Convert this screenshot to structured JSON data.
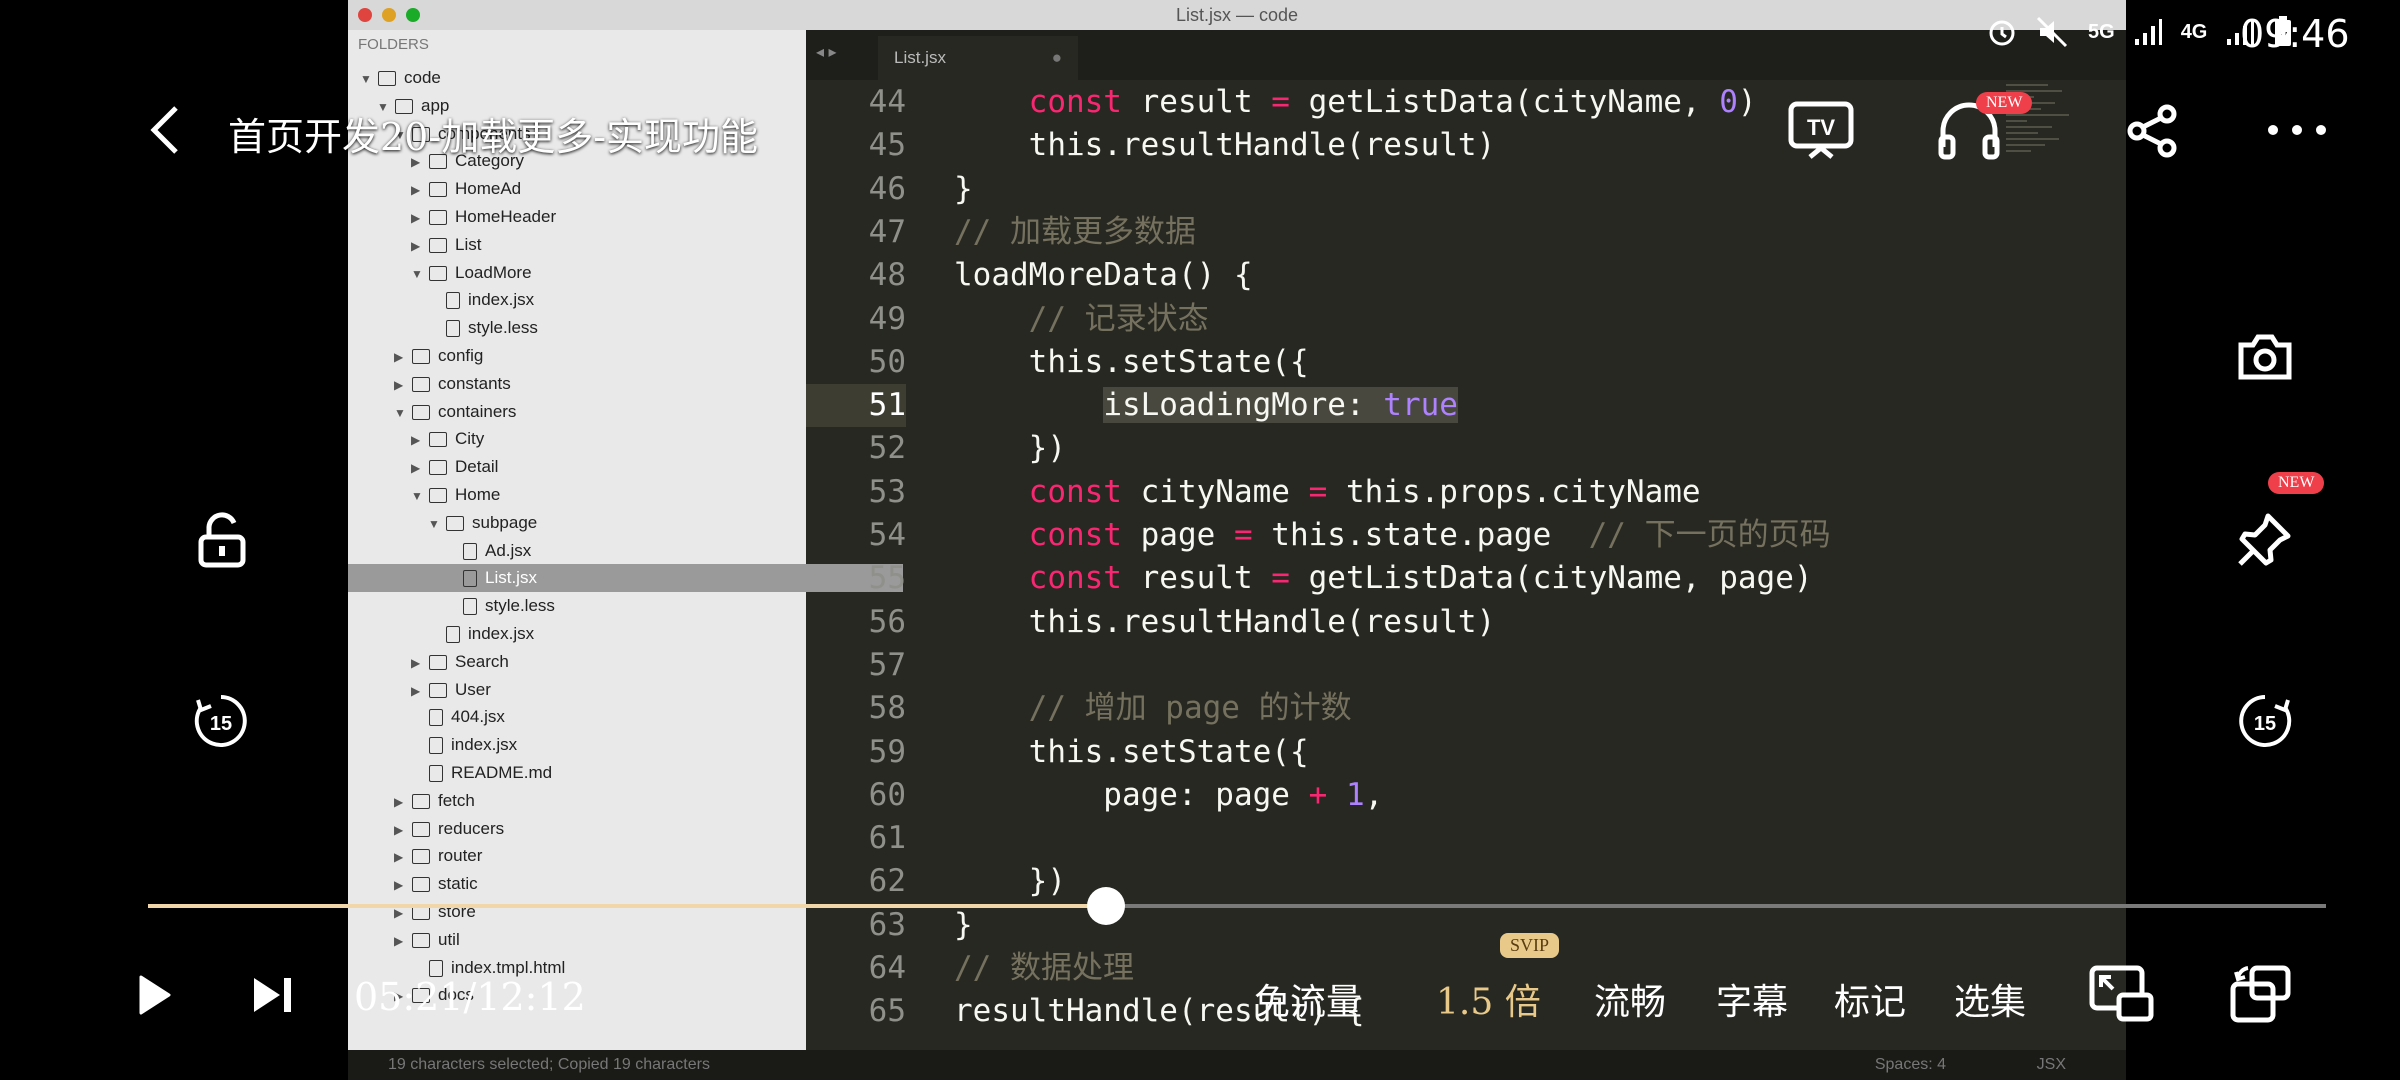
{
  "video_content": {
    "window_title": "List.jsx — code",
    "sidebar": {
      "header": "FOLDERS",
      "rows": [
        {
          "label": "code",
          "depth": 0,
          "open": true,
          "type": "folder"
        },
        {
          "label": "app",
          "depth": 1,
          "open": true,
          "type": "folder"
        },
        {
          "label": "components",
          "depth": 2,
          "open": true,
          "type": "folder"
        },
        {
          "label": "Category",
          "depth": 3,
          "open": false,
          "type": "folder"
        },
        {
          "label": "HomeAd",
          "depth": 3,
          "open": false,
          "type": "folder"
        },
        {
          "label": "HomeHeader",
          "depth": 3,
          "open": false,
          "type": "folder"
        },
        {
          "label": "List",
          "depth": 3,
          "open": false,
          "type": "folder"
        },
        {
          "label": "LoadMore",
          "depth": 3,
          "open": true,
          "type": "folder"
        },
        {
          "label": "index.jsx",
          "depth": 4,
          "type": "file"
        },
        {
          "label": "style.less",
          "depth": 4,
          "type": "file"
        },
        {
          "label": "config",
          "depth": 2,
          "open": false,
          "type": "folder"
        },
        {
          "label": "constants",
          "depth": 2,
          "open": false,
          "type": "folder"
        },
        {
          "label": "containers",
          "depth": 2,
          "open": true,
          "type": "folder"
        },
        {
          "label": "City",
          "depth": 3,
          "open": false,
          "type": "folder"
        },
        {
          "label": "Detail",
          "depth": 3,
          "open": false,
          "type": "folder"
        },
        {
          "label": "Home",
          "depth": 3,
          "open": true,
          "type": "folder"
        },
        {
          "label": "subpage",
          "depth": 4,
          "open": true,
          "type": "folder"
        },
        {
          "label": "Ad.jsx",
          "depth": 5,
          "type": "file"
        },
        {
          "label": "List.jsx",
          "depth": 5,
          "type": "file",
          "selected": true
        },
        {
          "label": "style.less",
          "depth": 5,
          "type": "file"
        },
        {
          "label": "index.jsx",
          "depth": 4,
          "type": "file"
        },
        {
          "label": "Search",
          "depth": 3,
          "open": false,
          "type": "folder"
        },
        {
          "label": "User",
          "depth": 3,
          "open": false,
          "type": "folder"
        },
        {
          "label": "404.jsx",
          "depth": 3,
          "type": "file"
        },
        {
          "label": "index.jsx",
          "depth": 3,
          "type": "file"
        },
        {
          "label": "README.md",
          "depth": 3,
          "type": "file"
        },
        {
          "label": "fetch",
          "depth": 2,
          "open": false,
          "type": "folder"
        },
        {
          "label": "reducers",
          "depth": 2,
          "open": false,
          "type": "folder"
        },
        {
          "label": "router",
          "depth": 2,
          "open": false,
          "type": "folder"
        },
        {
          "label": "static",
          "depth": 2,
          "open": false,
          "type": "folder"
        },
        {
          "label": "store",
          "depth": 2,
          "open": false,
          "type": "folder"
        },
        {
          "label": "util",
          "depth": 2,
          "open": false,
          "type": "folder"
        },
        {
          "label": "index.tmpl.html",
          "depth": 3,
          "type": "file"
        },
        {
          "label": "docs",
          "depth": 2,
          "open": false,
          "type": "folder"
        }
      ]
    },
    "tab_label": "List.jsx",
    "code_lines": [
      {
        "n": "44",
        "html": "    <span class='kw'>const</span> result <span class='op'>=</span> getListData(cityName, <span class='num'>0</span>)"
      },
      {
        "n": "45",
        "html": "    this.resultHandle(result)"
      },
      {
        "n": "46",
        "html": "}"
      },
      {
        "n": "47",
        "html": "<span class='cm'>// 加载更多数据</span>"
      },
      {
        "n": "48",
        "html": "loadMoreData() {"
      },
      {
        "n": "49",
        "html": "    <span class='cm'>// 记录状态</span>"
      },
      {
        "n": "50",
        "html": "    this.setState({"
      },
      {
        "n": "51",
        "html": "        <span class='hl'>isLoadingMore: <span class='num'>true</span></span>",
        "current": true
      },
      {
        "n": "52",
        "html": "    })"
      },
      {
        "n": "53",
        "html": "    <span class='kw'>const</span> cityName <span class='op'>=</span> this.props.cityName"
      },
      {
        "n": "54",
        "html": "    <span class='kw'>const</span> page <span class='op'>=</span> this.state.page  <span class='cm'>// 下一页的页码</span>"
      },
      {
        "n": "55",
        "html": "    <span class='kw'>const</span> result <span class='op'>=</span> getListData(cityName, page)"
      },
      {
        "n": "56",
        "html": "    this.resultHandle(result)"
      },
      {
        "n": "57",
        "html": ""
      },
      {
        "n": "58",
        "html": "    <span class='cm'>// 增加 page 的计数</span>"
      },
      {
        "n": "59",
        "html": "    this.setState({"
      },
      {
        "n": "60",
        "html": "        page: page <span class='op'>+</span> <span class='num'>1</span>,"
      },
      {
        "n": "61",
        "html": ""
      },
      {
        "n": "62",
        "html": "    })"
      },
      {
        "n": "63",
        "html": "}"
      },
      {
        "n": "64",
        "html": "<span class='cm'>// 数据处理</span>"
      },
      {
        "n": "65",
        "html": "resultHandle(result) {"
      }
    ],
    "status_left": "19 characters selected; Copied 19 characters",
    "status_spaces": "Spaces: 4",
    "status_syntax": "JSX"
  },
  "player": {
    "title": "首页开发20-加载更多-实现功能",
    "badge_new": "NEW",
    "time_display": "05:21/12:12",
    "progress_fraction": 0.4397,
    "controls": {
      "free_data": "免流量",
      "speed": "1.5 倍",
      "svip": "SVIP",
      "quality": "流畅",
      "subtitles": "字幕",
      "mark": "标记",
      "episodes": "选集"
    },
    "accent_color": "#e8c98a"
  },
  "status_bar": {
    "time": "09:46",
    "network_5g": "5G",
    "network_4g": "4G"
  }
}
